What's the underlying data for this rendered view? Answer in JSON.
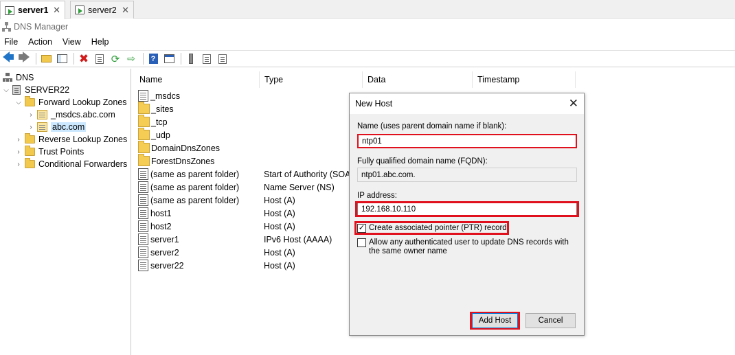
{
  "tabs": [
    {
      "label": "server1",
      "active": true
    },
    {
      "label": "server2",
      "active": false
    }
  ],
  "window": {
    "title": "DNS Manager"
  },
  "menu": {
    "items": [
      "File",
      "Action",
      "View",
      "Help"
    ]
  },
  "toolbar": {
    "icons": [
      "back-arrow-icon",
      "forward-arrow-icon",
      "folder-up-icon",
      "show-hide-tree-icon",
      "delete-icon",
      "properties-icon",
      "refresh-icon",
      "export-list-icon",
      "help-icon",
      "mmc-view-icon",
      "server-icon",
      "record-list-icon",
      "copy-icon"
    ]
  },
  "tree": {
    "root": "DNS",
    "server": "SERVER22",
    "forward_zones": "Forward Lookup Zones",
    "zone_msdcs": "_msdcs.abc.com",
    "zone_abc": "abc.com",
    "reverse_zones": "Reverse Lookup Zones",
    "trust_points": "Trust Points",
    "conditional_forwarders": "Conditional Forwarders"
  },
  "list": {
    "columns": [
      "Name",
      "Type",
      "Data",
      "Timestamp"
    ],
    "rows": [
      {
        "name": "_msdcs",
        "type": "",
        "icon": "zone"
      },
      {
        "name": "_sites",
        "type": "",
        "icon": "folder"
      },
      {
        "name": "_tcp",
        "type": "",
        "icon": "folder"
      },
      {
        "name": "_udp",
        "type": "",
        "icon": "folder"
      },
      {
        "name": "DomainDnsZones",
        "type": "",
        "icon": "folder"
      },
      {
        "name": "ForestDnsZones",
        "type": "",
        "icon": "folder"
      },
      {
        "name": "(same as parent folder)",
        "type": "Start of Authority (SOA)",
        "icon": "record"
      },
      {
        "name": "(same as parent folder)",
        "type": "Name Server (NS)",
        "icon": "record"
      },
      {
        "name": "(same as parent folder)",
        "type": "Host (A)",
        "icon": "record"
      },
      {
        "name": "host1",
        "type": "Host (A)",
        "icon": "record"
      },
      {
        "name": "host2",
        "type": "Host (A)",
        "icon": "record"
      },
      {
        "name": "server1",
        "type": "IPv6 Host (AAAA)",
        "icon": "record"
      },
      {
        "name": "server2",
        "type": "Host (A)",
        "icon": "record"
      },
      {
        "name": "server22",
        "type": "Host (A)",
        "icon": "record"
      }
    ]
  },
  "dialog": {
    "title": "New Host",
    "name_label": "Name (uses parent domain name if blank):",
    "name_value": "ntp01",
    "fqdn_label": "Fully qualified domain name (FQDN):",
    "fqdn_value": "ntp01.abc.com.",
    "ip_label": "IP address:",
    "ip_value": "192.168.10.110",
    "ptr_label": "Create associated pointer (PTR) record",
    "ptr_checked": true,
    "allow_label": "Allow any authenticated user to update DNS records with the same owner name",
    "allow_checked": false,
    "add_button": "Add Host",
    "cancel_button": "Cancel"
  },
  "colors": {
    "highlight": "#e0101c",
    "selection": "#cce8ff",
    "primary_border": "#0078d7"
  }
}
